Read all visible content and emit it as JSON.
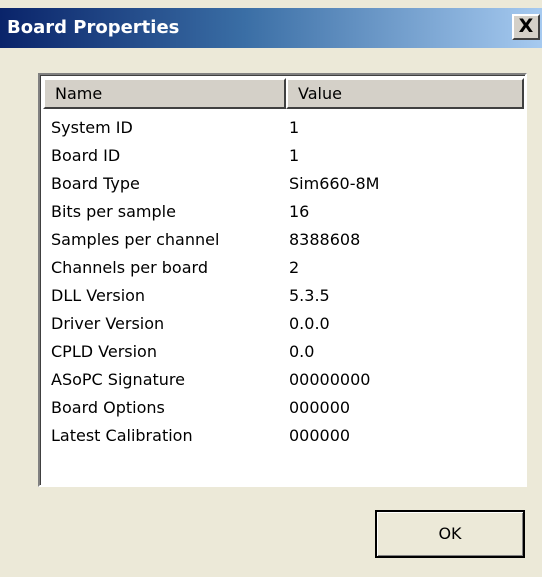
{
  "window": {
    "title": "Board Properties",
    "close_label": "X"
  },
  "list": {
    "columns": [
      "Name",
      "Value"
    ],
    "rows": [
      {
        "name": "System ID",
        "value": "1"
      },
      {
        "name": "Board ID",
        "value": "1"
      },
      {
        "name": "Board Type",
        "value": "Sim660-8M"
      },
      {
        "name": "Bits per sample",
        "value": "16"
      },
      {
        "name": "Samples per channel",
        "value": "8388608"
      },
      {
        "name": "Channels per board",
        "value": "2"
      },
      {
        "name": "DLL Version",
        "value": "5.3.5"
      },
      {
        "name": "Driver Version",
        "value": "0.0.0"
      },
      {
        "name": "CPLD Version",
        "value": "0.0"
      },
      {
        "name": "ASoPC Signature",
        "value": "00000000"
      },
      {
        "name": "Board Options",
        "value": "000000"
      },
      {
        "name": "Latest Calibration",
        "value": "000000"
      }
    ]
  },
  "buttons": {
    "ok_label": "OK"
  }
}
